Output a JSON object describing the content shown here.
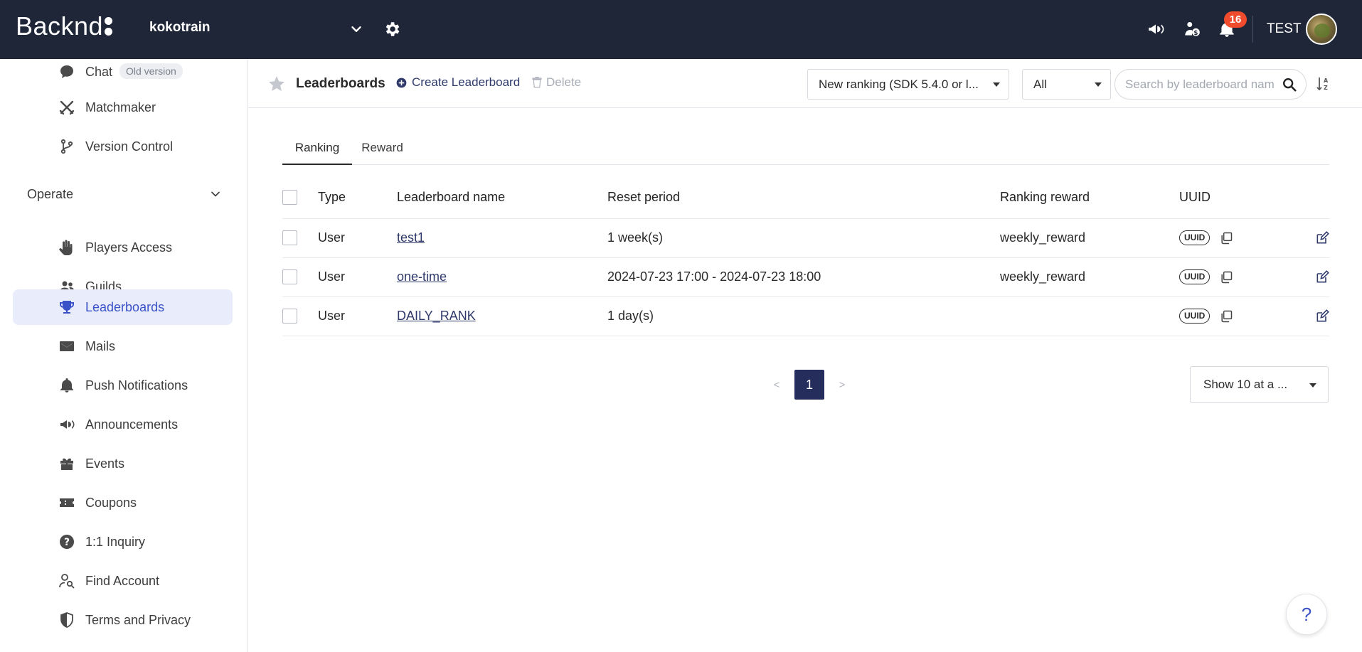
{
  "topbar": {
    "logo_text": "Backnd",
    "project_name": "kokotrain",
    "notification_count": "16",
    "user_name": "TEST"
  },
  "sidebar": {
    "items_top": [
      {
        "label": "Chat",
        "icon": "chat-icon",
        "badge": "Old version"
      },
      {
        "label": "Matchmaker",
        "icon": "swords-icon"
      },
      {
        "label": "Version Control",
        "icon": "branch-icon"
      }
    ],
    "section_label": "Operate",
    "items": [
      {
        "label": "Players Access",
        "icon": "hand-icon"
      },
      {
        "label": "Guilds",
        "icon": "group-icon"
      },
      {
        "label": "Leaderboards",
        "icon": "trophy-icon",
        "active": true
      },
      {
        "label": "Mails",
        "icon": "mail-icon"
      },
      {
        "label": "Push Notifications",
        "icon": "bell-icon"
      },
      {
        "label": "Announcements",
        "icon": "megaphone-icon"
      },
      {
        "label": "Events",
        "icon": "gift-icon"
      },
      {
        "label": "Coupons",
        "icon": "ticket-icon"
      },
      {
        "label": "1:1 Inquiry",
        "icon": "question-icon"
      },
      {
        "label": "Find Account",
        "icon": "user-search-icon"
      },
      {
        "label": "Terms and Privacy",
        "icon": "shield-icon"
      }
    ]
  },
  "toolbar": {
    "title": "Leaderboards",
    "create_label": "Create Leaderboard",
    "delete_label": "Delete",
    "ranking_select": "New ranking (SDK 5.4.0 or l...",
    "filter_select": "All",
    "search_placeholder": "Search by leaderboard nam"
  },
  "tabs": [
    {
      "label": "Ranking",
      "active": true
    },
    {
      "label": "Reward",
      "active": false
    }
  ],
  "table": {
    "headers": {
      "type": "Type",
      "name": "Leaderboard name",
      "reset": "Reset period",
      "reward": "Ranking reward",
      "uuid": "UUID"
    },
    "uuid_badge": "UUID",
    "rows": [
      {
        "type": "User",
        "name": "test1",
        "reset": "1 week(s)",
        "reward": "weekly_reward"
      },
      {
        "type": "User",
        "name": "one-time",
        "reset": "2024-07-23 17:00 - 2024-07-23 18:00",
        "reward": "weekly_reward"
      },
      {
        "type": "User",
        "name": "DAILY_RANK",
        "reset": "1 day(s)",
        "reward": ""
      }
    ]
  },
  "pagination": {
    "prev": "<",
    "current": "1",
    "next": ">",
    "page_size_label": "Show 10 at a ..."
  },
  "help_label": "?",
  "colors": {
    "topbar_bg": "#1f2638",
    "accent": "#3a52c8",
    "active_bg": "#e9ecfb",
    "badge": "#f04b2c",
    "page_active": "#252d5c"
  }
}
